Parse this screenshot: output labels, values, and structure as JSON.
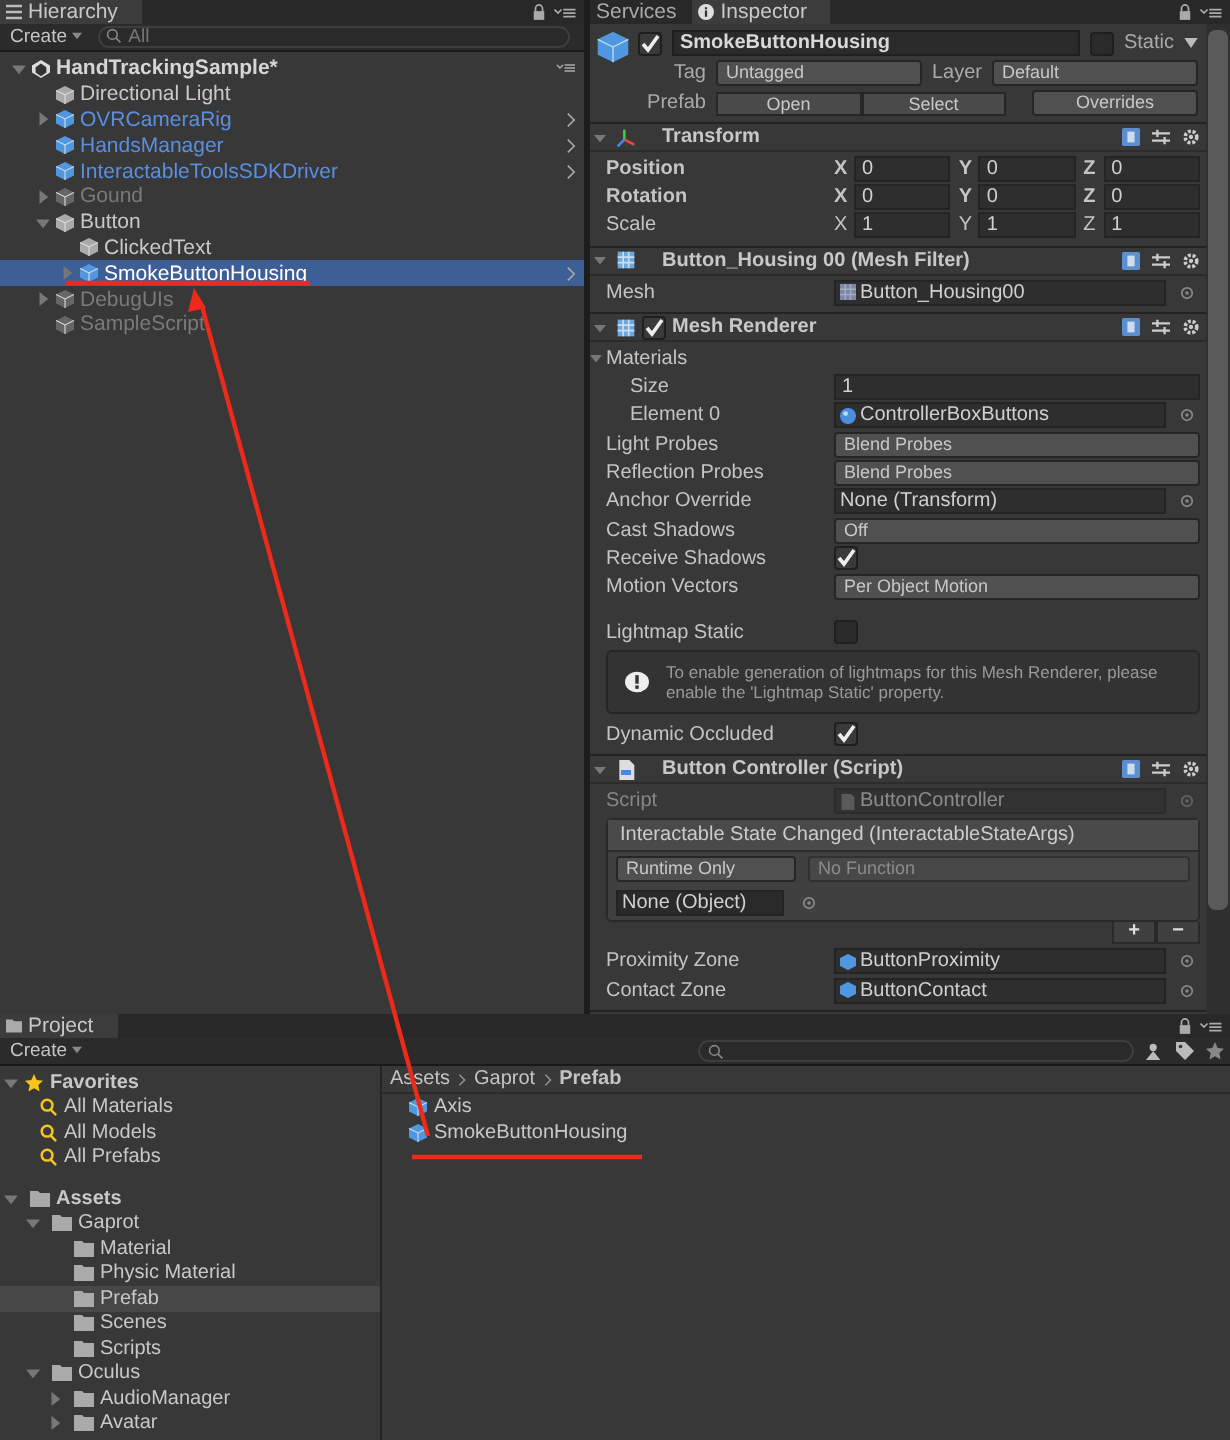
{
  "hierarchy": {
    "tab": "Hierarchy",
    "create": "Create",
    "search_placeholder": "All",
    "tree": [
      {
        "label": "HandTrackingSample*",
        "kind": "scene",
        "expanded": true,
        "selected": false,
        "children": [
          {
            "label": "Directional Light",
            "kind": "normal",
            "selected": false
          },
          {
            "label": "OVRCameraRig",
            "kind": "prefab",
            "expanded": false,
            "selected": false
          },
          {
            "label": "HandsManager",
            "kind": "prefab",
            "selected": false
          },
          {
            "label": "InteractableToolsSDKDriver",
            "kind": "prefab",
            "selected": false
          },
          {
            "label": "Gound",
            "kind": "inactive",
            "expanded": false,
            "selected": false
          },
          {
            "label": "Button",
            "kind": "normal",
            "expanded": true,
            "selected": false,
            "children": [
              {
                "label": "ClickedText",
                "kind": "normal",
                "selected": false
              },
              {
                "label": "SmokeButtonHousing",
                "kind": "prefab",
                "expanded": false,
                "selected": true
              }
            ]
          },
          {
            "label": "DebugUIs",
            "kind": "inactive",
            "expanded": false,
            "selected": false
          },
          {
            "label": "SampleScript",
            "kind": "inactive",
            "selected": false
          }
        ]
      }
    ]
  },
  "inspector": {
    "tabs": [
      {
        "label": "Services",
        "selected": false
      },
      {
        "label": "Inspector",
        "selected": true
      }
    ],
    "object": {
      "name": "SmokeButtonHousing",
      "active": true,
      "static_label": "Static",
      "static": false,
      "tag_label": "Tag",
      "tag": "Untagged",
      "layer_label": "Layer",
      "layer": "Default",
      "prefab_label": "Prefab",
      "prefab_buttons": [
        "Open",
        "Select"
      ],
      "overrides": "Overrides"
    },
    "components": [
      {
        "title": "Transform",
        "rows": [
          {
            "kind": "vector3",
            "label": "Position",
            "bold": true,
            "axes": [
              {
                "axis": "X",
                "value": "0"
              },
              {
                "axis": "Y",
                "value": "0"
              },
              {
                "axis": "Z",
                "value": "0"
              }
            ]
          },
          {
            "kind": "vector3",
            "label": "Rotation",
            "bold": true,
            "axes": [
              {
                "axis": "X",
                "value": "0"
              },
              {
                "axis": "Y",
                "value": "0"
              },
              {
                "axis": "Z",
                "value": "0"
              }
            ]
          },
          {
            "kind": "vector3",
            "label": "Scale",
            "bold": false,
            "axes": [
              {
                "axis": "X",
                "value": "1"
              },
              {
                "axis": "Y",
                "value": "1"
              },
              {
                "axis": "Z",
                "value": "1"
              }
            ]
          }
        ]
      },
      {
        "title": "Button_Housing 00 (Mesh Filter)",
        "rows": [
          {
            "kind": "mesh",
            "label": "Mesh",
            "value": "Button_Housing00"
          }
        ]
      },
      {
        "title": "Mesh Renderer",
        "enabled": true,
        "rows": [
          {
            "kind": "foldout",
            "label": "Materials",
            "expanded": true
          },
          {
            "kind": "field",
            "label": "Size",
            "indent": true,
            "value": "1"
          },
          {
            "kind": "material",
            "label": "Element 0",
            "indent": true,
            "value": "ControllerBoxButtons"
          },
          {
            "kind": "dropdown",
            "label": "Light Probes",
            "value": "Blend Probes"
          },
          {
            "kind": "dropdown",
            "label": "Reflection Probes",
            "value": "Blend Probes"
          },
          {
            "kind": "reference",
            "label": "Anchor Override",
            "value": "None (Transform)"
          },
          {
            "kind": "dropdown",
            "label": "Cast Shadows",
            "value": "Off"
          },
          {
            "kind": "checkbox",
            "label": "Receive Shadows",
            "checked": true
          },
          {
            "kind": "dropdown",
            "label": "Motion Vectors",
            "value": "Per Object Motion"
          },
          {
            "kind": "spacer"
          },
          {
            "kind": "checkbox",
            "label": "Lightmap Static",
            "checked": false
          },
          {
            "kind": "info",
            "text": "To enable generation of lightmaps for this Mesh Renderer, please enable the 'Lightmap Static' property."
          },
          {
            "kind": "checkbox",
            "label": "Dynamic Occluded",
            "checked": true
          }
        ]
      },
      {
        "title": "Button Controller (Script)",
        "rows": [
          {
            "kind": "script",
            "label": "Script",
            "value": "ButtonController",
            "disabled": true
          },
          {
            "kind": "event",
            "title": "Interactable State Changed (InteractableStateArgs)",
            "mode": "Runtime Only",
            "function": "No Function",
            "target": "None (Object)",
            "add": "+",
            "remove": "−"
          },
          {
            "kind": "prefab",
            "label": "Proximity Zone",
            "value": "ButtonProximity"
          },
          {
            "kind": "prefab",
            "label": "Contact Zone",
            "value": "ButtonContact"
          }
        ]
      }
    ]
  },
  "project": {
    "tab": "Project",
    "create": "Create",
    "favorites": {
      "label": "Favorites",
      "items": [
        "All Materials",
        "All Models",
        "All Prefabs"
      ]
    },
    "assets": {
      "label": "Assets",
      "expanded": true,
      "selected": false,
      "children": [
        {
          "label": "Gaprot",
          "expanded": true,
          "selected": false,
          "children": [
            {
              "label": "Material",
              "selected": false
            },
            {
              "label": "Physic Material",
              "selected": false
            },
            {
              "label": "Prefab",
              "selected": true
            },
            {
              "label": "Scenes",
              "selected": false
            },
            {
              "label": "Scripts",
              "selected": false
            }
          ]
        },
        {
          "label": "Oculus",
          "expanded": true,
          "selected": false,
          "children": [
            {
              "label": "AudioManager",
              "expanded": false,
              "selected": false
            },
            {
              "label": "Avatar",
              "expanded": false,
              "selected": false
            }
          ]
        }
      ]
    },
    "breadcrumb": [
      "Assets",
      "Gaprot",
      "Prefab"
    ],
    "items": [
      "Axis",
      "SmokeButtonHousing"
    ]
  }
}
